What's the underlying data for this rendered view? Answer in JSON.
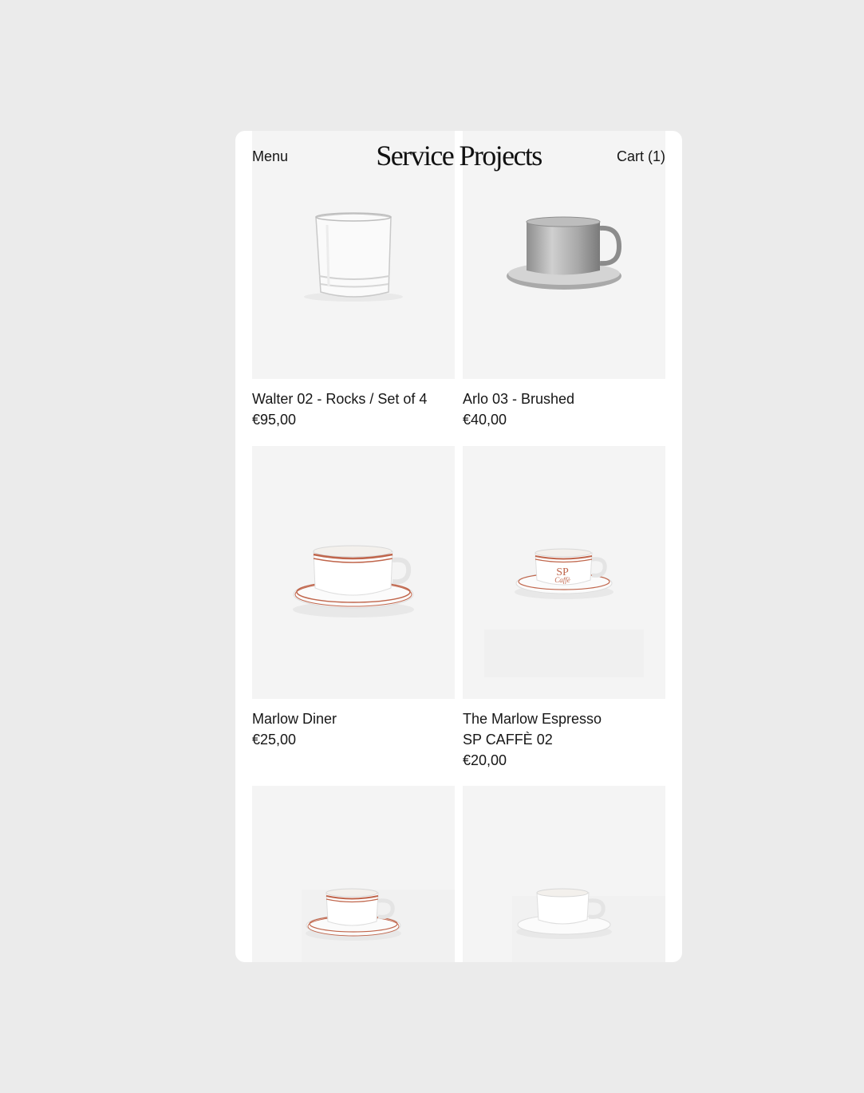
{
  "header": {
    "menu_label": "Menu",
    "logo_text": "Service Projects",
    "cart_label": "Cart (1)"
  },
  "products": [
    {
      "title": "Walter 02 - Rocks / Set of 4",
      "subtitle": "",
      "price": "€95,00",
      "image": "rocks-glass"
    },
    {
      "title": "Arlo 03 - Brushed",
      "subtitle": "",
      "price": "€40,00",
      "image": "steel-cup-saucer"
    },
    {
      "title": "Marlow Diner",
      "subtitle": "",
      "price": "€25,00",
      "image": "diner-cup-red-stripe"
    },
    {
      "title": "The Marlow Espresso",
      "subtitle": "SP CAFFÈ 02",
      "price": "€20,00",
      "image": "espresso-cup-caffe-logo"
    },
    {
      "title": "",
      "subtitle": "",
      "price": "",
      "image": "espresso-cup-red-stripe"
    },
    {
      "title": "",
      "subtitle": "",
      "price": "",
      "image": "espresso-cup-plain"
    }
  ],
  "colors": {
    "page_bg": "#ebebeb",
    "card_bg": "#ffffff",
    "image_bg": "#f4f4f4",
    "text": "#161616",
    "stripe_red": "#c0664c"
  }
}
